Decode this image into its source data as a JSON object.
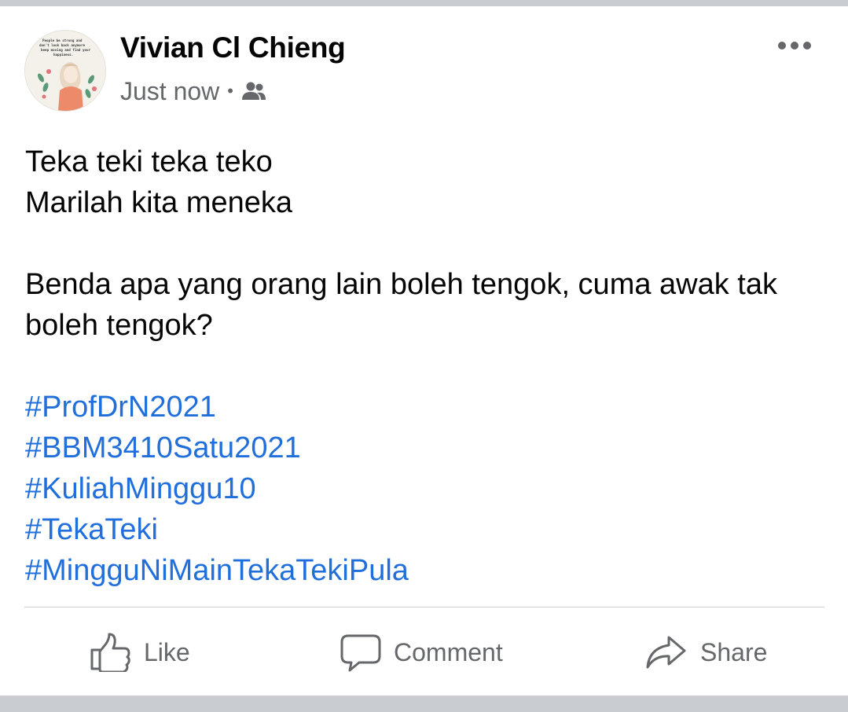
{
  "post": {
    "author": "Vivian Cl Chieng",
    "timestamp": "Just now",
    "separator": "•",
    "audience_icon": "friends-icon",
    "avatar_text": "People be strong and don't look back anymore keep moving and find your happiness",
    "text_lines": [
      "Teka teki teka teko",
      "Marilah kita meneka",
      "",
      "Benda apa yang orang lain boleh tengok, cuma awak tak",
      "boleh tengok?",
      ""
    ],
    "hashtags": [
      "#ProfDrN2021",
      "#BBM3410Satu2021",
      "#KuliahMinggu10",
      "#TekaTeki",
      "#MingguNiMainTekaTekiPula"
    ]
  },
  "actions": {
    "like": "Like",
    "comment": "Comment",
    "share": "Share"
  },
  "colors": {
    "hashtag": "#216fdb",
    "secondary_text": "#65676b",
    "separator_bar": "#c9ccd1"
  }
}
